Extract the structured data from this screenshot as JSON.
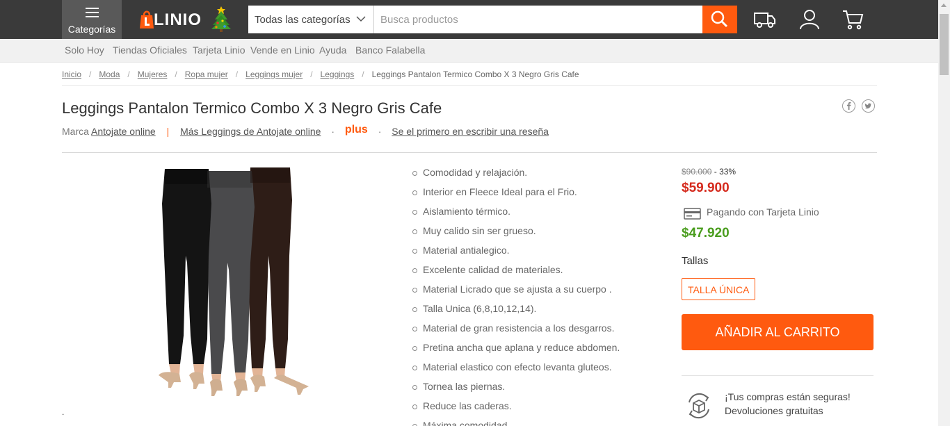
{
  "header": {
    "categories_label": "Categorías",
    "logo_text": "LINIO",
    "search_category": "Todas las categorías",
    "search_placeholder": "Busca productos",
    "accent_color": "#ff5a0f",
    "icons": [
      "hamburger-icon",
      "tree-icon",
      "chevron-down-icon",
      "search-icon",
      "truck-icon",
      "user-icon",
      "cart-icon"
    ]
  },
  "subnav": [
    "Solo Hoy",
    "Tiendas Oficiales",
    "Tarjeta Linio",
    "Vende en Linio",
    "Ayuda",
    "Banco Falabella"
  ],
  "breadcrumb": {
    "links": [
      "Inicio",
      "Moda",
      "Mujeres",
      "Ropa mujer",
      "Leggings mujer",
      "Leggings"
    ],
    "separator": "/",
    "current": "Leggings Pantalon Termico Combo X 3 Negro Gris Cafe"
  },
  "product": {
    "title": "Leggings Pantalon Termico Combo X 3 Negro Gris Cafe",
    "brand_prefix": "Marca",
    "brand": "Antojate online",
    "meta_sep": "|",
    "more_link": "Más Leggings de Antojate online",
    "meta_dot": "·",
    "plus": "plus",
    "review_link": "Se el primero en escribir una reseña",
    "bottom_mark": "."
  },
  "features": [
    "Comodidad y relajación.",
    "Interior en Fleece Ideal para el Frio.",
    "Aislamiento térmico.",
    "Muy calido sin ser grueso.",
    "Material antialegico.",
    "Excelente calidad de materiales.",
    "Material Licrado que se ajusta a su cuerpo .",
    "Talla Unica (6,8,10,12,14).",
    "Material de gran resistencia a los desgarros.",
    "Pretina ancha que aplana y reduce abdomen.",
    "Material elastico con efecto levanta gluteos.",
    "Tornea las piernas.",
    "Reduce las caderas.",
    "Máxima comodidad."
  ],
  "buybox": {
    "old_price": "$90.000",
    "discount": "- 33%",
    "price": "$59.900",
    "card_label": "Pagando con Tarjeta Linio",
    "card_price": "$47.920",
    "sizes_label": "Tallas",
    "size": "TALLA ÚNICA",
    "add_to_cart": "AÑADIR AL CARRITO",
    "secure_line1": "¡Tus compras están seguras!",
    "secure_line2": "Devoluciones gratuitas"
  }
}
